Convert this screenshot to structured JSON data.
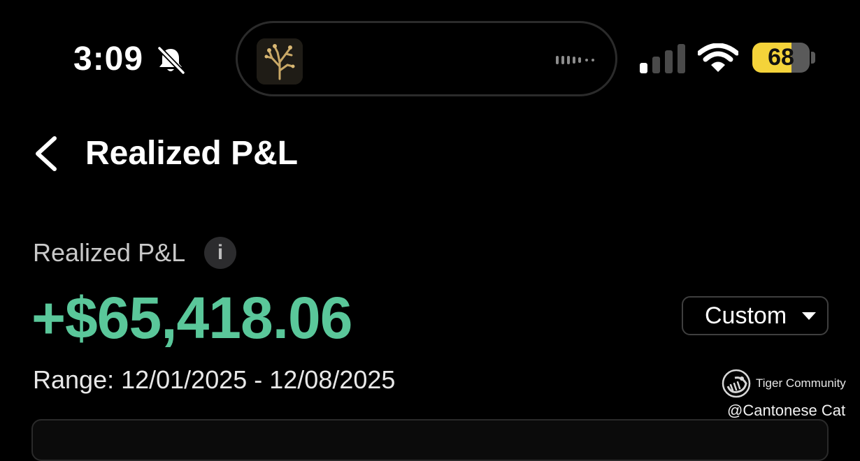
{
  "status_bar": {
    "time": "3:09",
    "battery_percent": 68,
    "battery_label": "68",
    "silent_mode": true,
    "signal_bars_active": 1,
    "signal_bars_total": 4,
    "icons": [
      "bell-slash-icon",
      "waveform-icon",
      "signal-icon",
      "wifi-icon",
      "battery-icon"
    ],
    "colors": {
      "battery_fill": "#f4d33a"
    }
  },
  "header": {
    "back_icon": "chevron-left-icon",
    "title": "Realized P&L"
  },
  "summary": {
    "label": "Realized P&L",
    "info_icon": "info-icon",
    "info_glyph": "i",
    "value": "+$65,418.06",
    "range_text": "Range: 12/01/2025 - 12/08/2025",
    "range_selector": {
      "selected": "Custom",
      "icon": "caret-down-icon"
    },
    "colors": {
      "gain": "#5ac79a"
    }
  },
  "watermark": {
    "community": "Tiger Community",
    "handle": "@Cantonese Cat"
  }
}
